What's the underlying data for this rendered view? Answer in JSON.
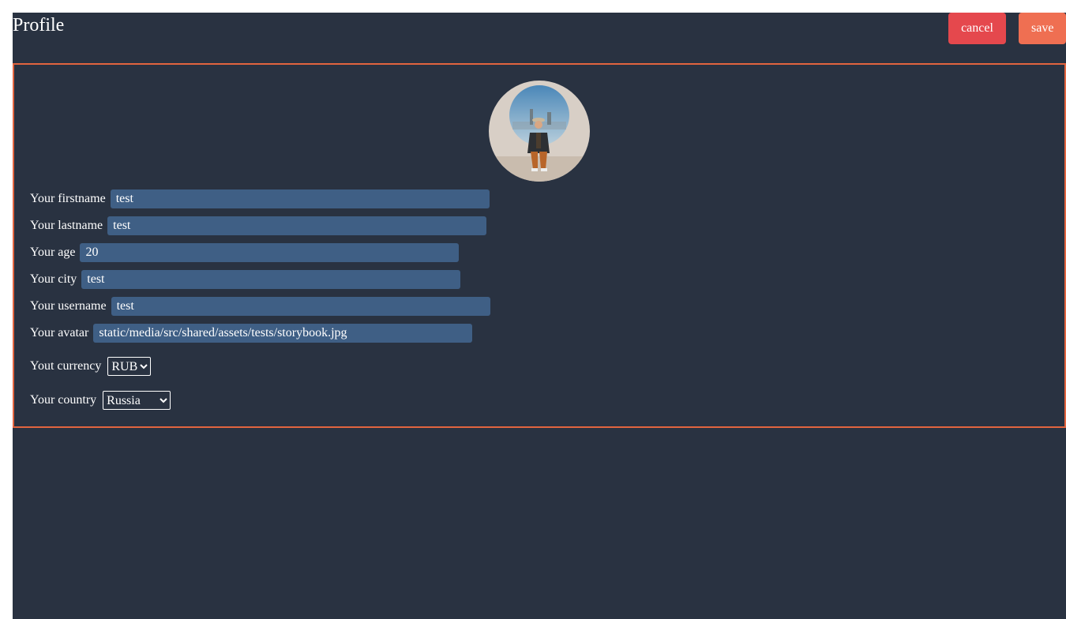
{
  "header": {
    "title": "Profile",
    "cancel_label": "cancel",
    "save_label": "save"
  },
  "colors": {
    "background": "#293241",
    "accent_border": "#e2643f",
    "cancel": "#e5484d",
    "save": "#ef6f52",
    "input_bg": "#3f5f85"
  },
  "profile": {
    "avatar_icon": "avatar-image",
    "fields": {
      "firstname": {
        "label": "Your firstname",
        "value": "test"
      },
      "lastname": {
        "label": "Your lastname",
        "value": "test"
      },
      "age": {
        "label": "Your age",
        "value": "20"
      },
      "city": {
        "label": "Your city",
        "value": "test"
      },
      "username": {
        "label": "Your username",
        "value": "test"
      },
      "avatar": {
        "label": "Your avatar",
        "value": "static/media/src/shared/assets/tests/storybook.jpg"
      }
    },
    "currency": {
      "label": "Yout currency",
      "selected": "RUB"
    },
    "country": {
      "label": "Your country",
      "selected": "Russia"
    }
  }
}
